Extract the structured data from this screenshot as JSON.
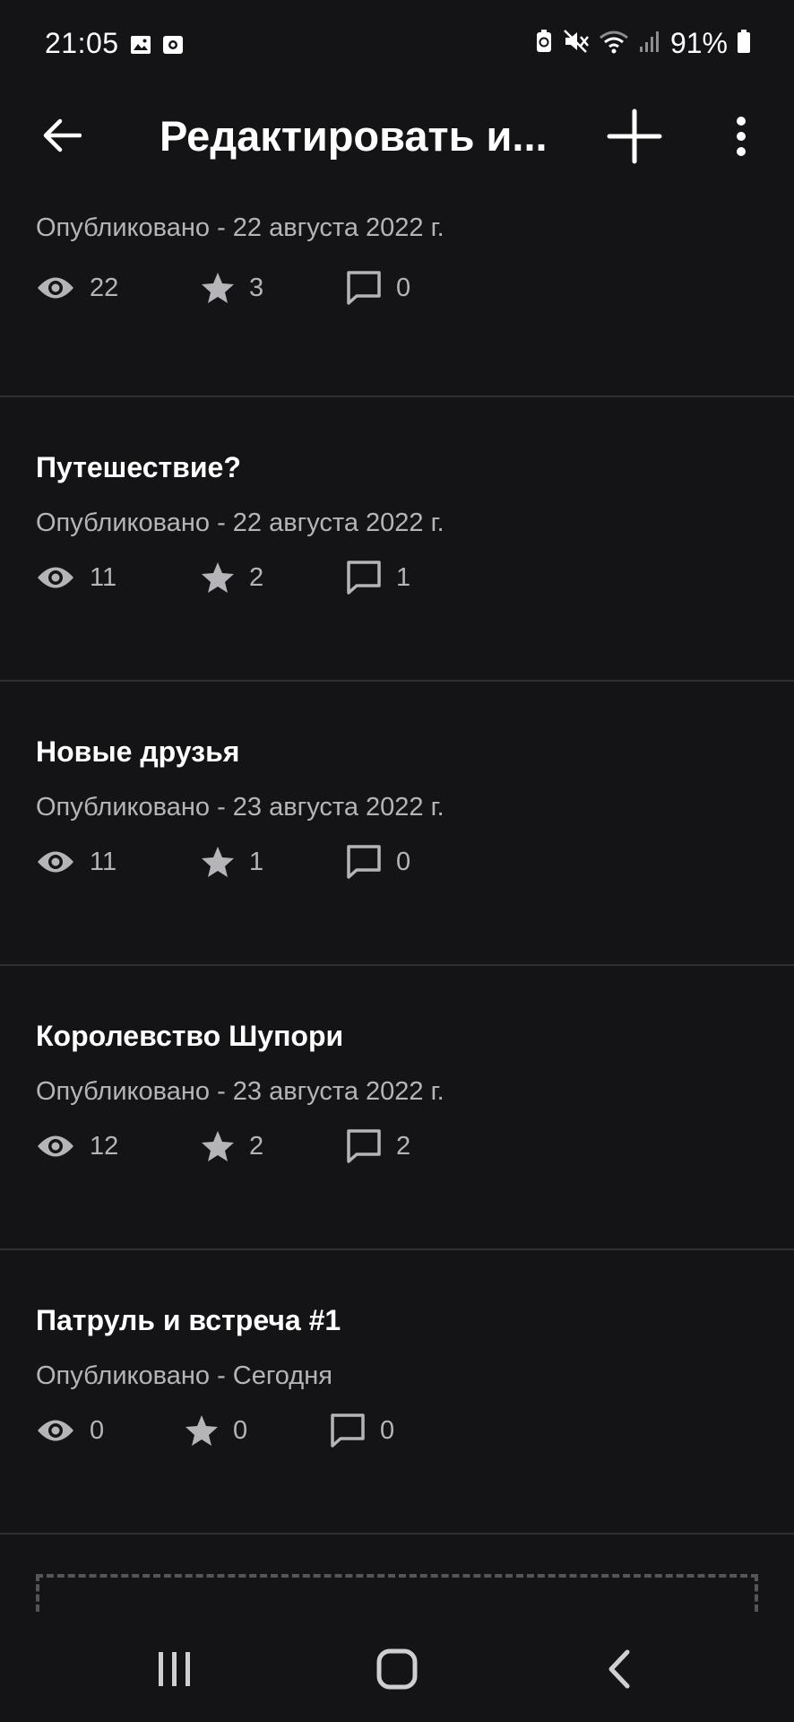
{
  "status_bar": {
    "time": "21:05",
    "battery_percent": "91%",
    "icons": [
      "gallery-icon",
      "screen-record-icon",
      "battery-saver-icon",
      "mute-icon",
      "wifi-icon",
      "signal-icon",
      "battery-icon"
    ]
  },
  "app_bar": {
    "title": "Редактировать и...",
    "back_icon": "arrow-left-icon",
    "add_icon": "plus-icon",
    "more_icon": "more-vertical-icon"
  },
  "posts": [
    {
      "title": "",
      "meta": "Опубликовано - 22 августа 2022 г.",
      "views": "22",
      "stars": "3",
      "comments": "0"
    },
    {
      "title": "Путешествие?",
      "meta": "Опубликовано - 22 августа 2022 г.",
      "views": "11",
      "stars": "2",
      "comments": "1"
    },
    {
      "title": "Новые друзья",
      "meta": "Опубликовано - 23 августа 2022 г.",
      "views": "11",
      "stars": "1",
      "comments": "0"
    },
    {
      "title": "Королевство Шупори",
      "meta": "Опубликовано - 23 августа 2022 г.",
      "views": "12",
      "stars": "2",
      "comments": "2"
    },
    {
      "title": "Патруль и встреча #1",
      "meta": "Опубликовано - Сегодня",
      "views": "0",
      "stars": "0",
      "comments": "0"
    }
  ],
  "colors": {
    "background": "#141316",
    "text_primary": "#ffffff",
    "text_secondary": "#b5b4b8",
    "divider": "#2f2e32"
  },
  "nav_bar": {
    "icons": [
      "recent-apps-icon",
      "home-icon",
      "back-icon"
    ]
  }
}
